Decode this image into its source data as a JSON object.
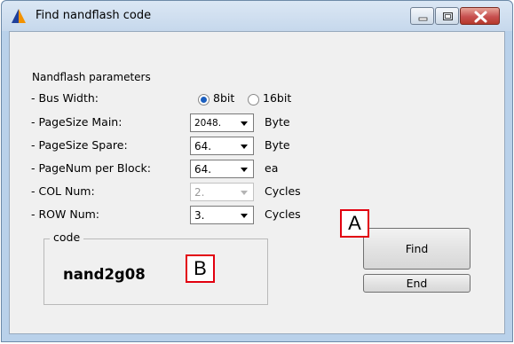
{
  "window": {
    "title": "Find nandflash code",
    "icon": "blue-orange-triangle-app-icon",
    "controls": [
      "minimize-icon",
      "maximize-icon",
      "close-icon"
    ]
  },
  "params": {
    "group_title": "Nandflash parameters",
    "bus_width": {
      "label": "- Bus Width:",
      "options": [
        "8bit",
        "16bit"
      ],
      "selected": "8bit"
    },
    "page_size_main": {
      "label": "- PageSize Main:",
      "value": "2048.",
      "unit": "Byte"
    },
    "page_size_spare": {
      "label": "- PageSize Spare:",
      "value": "64.",
      "unit": "Byte"
    },
    "page_num": {
      "label": "- PageNum per Block:",
      "value": "64.",
      "unit": "ea"
    },
    "col_num": {
      "label": "- COL Num:",
      "value": "2.",
      "unit": "Cycles",
      "disabled": true
    },
    "row_num": {
      "label": "- ROW Num:",
      "value": "3.",
      "unit": "Cycles"
    }
  },
  "code": {
    "legend": "code",
    "value": "nand2g08"
  },
  "buttons": {
    "find": "Find",
    "end": "End"
  },
  "callouts": {
    "a": "A",
    "b": "B"
  },
  "colors": {
    "titlebar": "#c6d8ec",
    "close_button": "#c75050",
    "callout_border": "#e2000f"
  }
}
